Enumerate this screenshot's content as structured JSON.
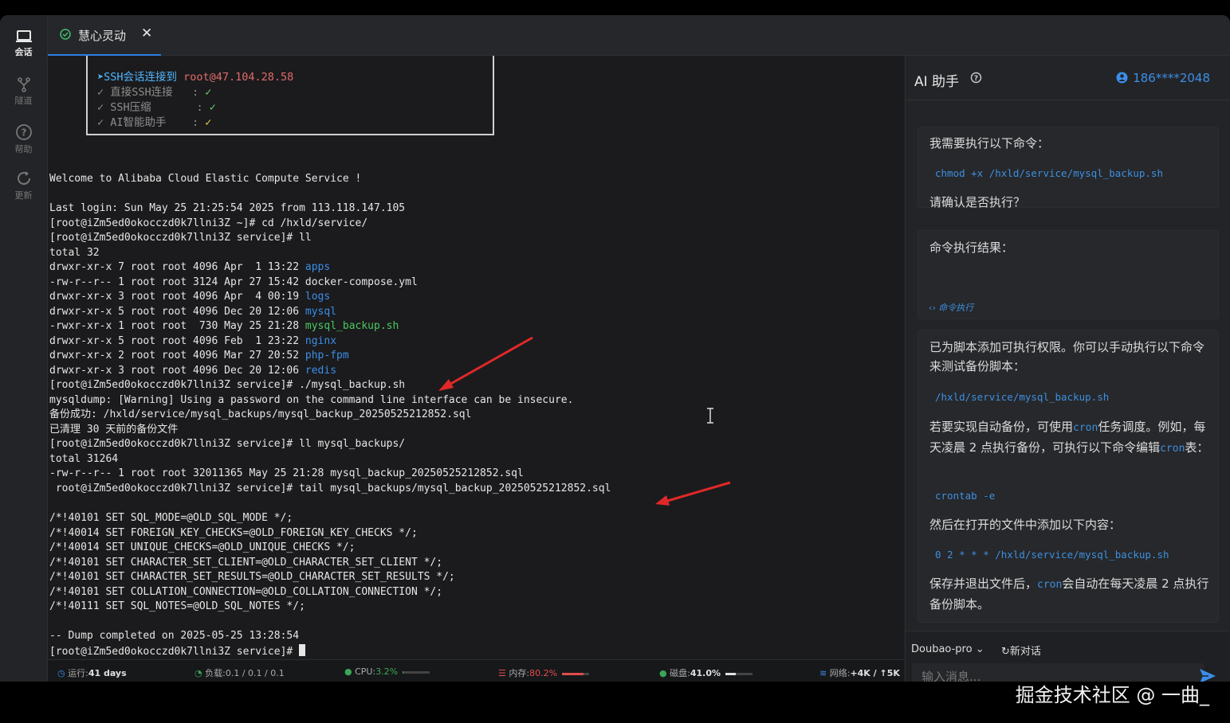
{
  "rail": [
    {
      "label": "会话",
      "icon": "laptop-icon",
      "active": true
    },
    {
      "label": "隧道",
      "icon": "tunnel-icon",
      "active": false
    },
    {
      "label": "帮助",
      "icon": "help-icon",
      "active": false
    },
    {
      "label": "更新",
      "icon": "refresh-icon",
      "active": false
    }
  ],
  "tab": {
    "title": "慧心灵动",
    "close": "✕"
  },
  "banner": {
    "line1_prefix": "➤SSH会话连接到 ",
    "line1_host": "root@47.104.28.58",
    "line2_label": "✓ 直接SSH连接   : ",
    "line2_mark": "✓",
    "line3_label": "✓ SSH压缩       : ",
    "line3_mark": "✓",
    "line4_label": "✓ AI智能助手    : ",
    "line4_mark": "✓"
  },
  "terminal": {
    "welcome": "Welcome to Alibaba Cloud Elastic Compute Service !",
    "last_login": "Last login: Sun May 25 21:25:54 2025 from 113.118.147.105",
    "cmd_cd": "[root@iZm5ed0okocczd0k7llni3Z ~]# cd /hxld/service/",
    "cmd_ll": "[root@iZm5ed0okocczd0k7llni3Z service]# ll",
    "total1": "total 32",
    "ls": [
      {
        "meta": "drwxr-xr-x 7 root root 4096 Apr  1 13:22 ",
        "name": "apps",
        "cls": "blue"
      },
      {
        "meta": "-rw-r--r-- 1 root root 3124 Apr 27 15:42 ",
        "name": "docker-compose.yml",
        "cls": ""
      },
      {
        "meta": "drwxr-xr-x 3 root root 4096 Apr  4 00:19 ",
        "name": "logs",
        "cls": "blue"
      },
      {
        "meta": "drwxr-xr-x 5 root root 4096 Dec 20 12:06 ",
        "name": "mysql",
        "cls": "blue"
      },
      {
        "meta": "-rwxr-xr-x 1 root root  730 May 25 21:28 ",
        "name": "mysql_backup.sh",
        "cls": "green"
      },
      {
        "meta": "drwxr-xr-x 5 root root 4096 Feb  1 23:22 ",
        "name": "nginx",
        "cls": "blue"
      },
      {
        "meta": "drwxr-xr-x 2 root root 4096 Mar 27 20:52 ",
        "name": "php-fpm",
        "cls": "blue"
      },
      {
        "meta": "drwxr-xr-x 3 root root 4096 Dec 20 12:06 ",
        "name": "redis",
        "cls": "blue"
      }
    ],
    "cmd_run": "[root@iZm5ed0okocczd0k7llni3Z service]# ./mysql_backup.sh",
    "warn": "mysqldump: [Warning] Using a password on the command line interface can be insecure.",
    "backup_ok": "备份成功: /hxld/service/mysql_backups/mysql_backup_20250525212852.sql",
    "cleaned": "已清理 30 天前的备份文件",
    "cmd_ll2": "[root@iZm5ed0okocczd0k7llni3Z service]# ll mysql_backups/",
    "total2": "total 31264",
    "file": "-rw-r--r-- 1 root root 32011365 May 25 21:28 mysql_backup_20250525212852.sql",
    "cmd_tail": " root@iZm5ed0okocczd0k7llni3Z service]# tail mysql_backups/mysql_backup_20250525212852.sql",
    "sql": [
      "/*!40101 SET SQL_MODE=@OLD_SQL_MODE */;",
      "/*!40014 SET FOREIGN_KEY_CHECKS=@OLD_FOREIGN_KEY_CHECKS */;",
      "/*!40014 SET UNIQUE_CHECKS=@OLD_UNIQUE_CHECKS */;",
      "/*!40101 SET CHARACTER_SET_CLIENT=@OLD_CHARACTER_SET_CLIENT */;",
      "/*!40101 SET CHARACTER_SET_RESULTS=@OLD_CHARACTER_SET_RESULTS */;",
      "/*!40101 SET COLLATION_CONNECTION=@OLD_COLLATION_CONNECTION */;",
      "/*!40111 SET SQL_NOTES=@OLD_SQL_NOTES */;"
    ],
    "dump_done": "-- Dump completed on 2025-05-25 13:28:54",
    "prompt": "[root@iZm5ed0okocczd0k7llni3Z service]# "
  },
  "status": {
    "uptime_label": "运行:",
    "uptime_value": "41 days",
    "load_label": "负载:",
    "load_value": "0.1 / 0.1 / 0.1",
    "cpu_label": "CPU:",
    "cpu_value": "3.2%",
    "cpu_fraction": 0.032,
    "mem_label": "内存:",
    "mem_value": "80.2%",
    "mem_fraction": 0.802,
    "disk_label": "磁盘:",
    "disk_value": "41.0%",
    "disk_fraction": 0.41,
    "net_label": "网络:",
    "net_value": "+4K / ↑5K",
    "colors": {
      "cpu": "#3aa657",
      "mem": "#e24c4c",
      "disk": "#e0e0e0"
    }
  },
  "ai": {
    "title": "AI 助手",
    "user": "186****2048",
    "m1_line1": "我需要执行以下命令：",
    "m1_code": "chmod +x /hxld/service/mysql_backup.sh",
    "m1_line2": "请确认是否执行？",
    "m2_line1": "命令执行结果：",
    "m2_exec": "‹› 命令执行",
    "m3_p1": "已为脚本添加可执行权限。你可以手动执行以下命令来测试备份脚本：",
    "m3_code1": "/hxld/service/mysql_backup.sh",
    "m3_p2a": "若要实现自动备份，可使用",
    "m3_cron": "cron",
    "m3_p2b": "任务调度。例如，每天凌晨 2 点执行备份，可执行以下命令编辑",
    "m3_p2c": "表：",
    "m3_code2": "crontab -e",
    "m3_p3": "然后在打开的文件中添加以下内容：",
    "m3_code3": "0 2 * * * /hxld/service/mysql_backup.sh",
    "m3_p4a": "保存并退出文件后，",
    "m3_p4b": "会自动在每天凌晨 2 点执行备份脚本。",
    "model": "Doubao-pro",
    "model_caret": "⌄",
    "new_chat": "新对话",
    "input_placeholder": "输入消息..."
  },
  "watermark": "掘金技术社区 @ 一曲_"
}
